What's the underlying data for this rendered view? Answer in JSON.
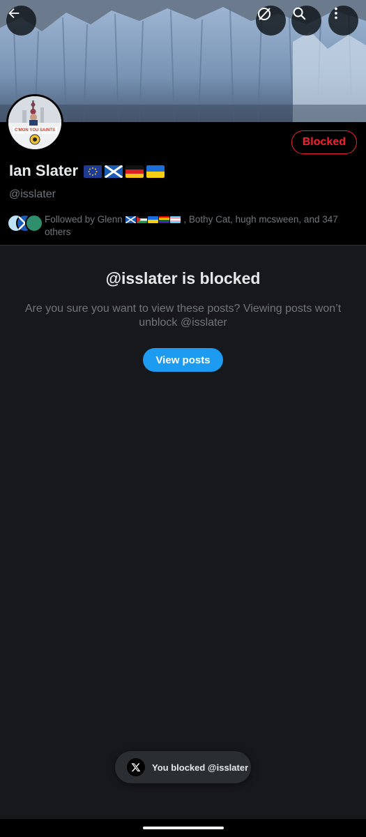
{
  "profile": {
    "name": "Ian Slater",
    "handle": "@isslater",
    "followed_by": "Followed by Glenn",
    "followed_by_rest": ", Bothy Cat, hugh mcsween, and 347 others",
    "avatar_caption": "C'MON YOU SAINTS"
  },
  "header": {
    "blocked_label": "Blocked"
  },
  "icons": {
    "back": "back-arrow-icon",
    "grok": "grok-icon",
    "search": "search-icon",
    "more": "more-vertical-icon"
  },
  "blocked_panel": {
    "title": "@isslater is blocked",
    "description": "Are you sure you want to view these posts? Viewing posts won’t unblock @isslater",
    "view_button": "View posts"
  },
  "toast": {
    "text": "You blocked @isslater"
  },
  "colors": {
    "accent": "#1d9bf0",
    "danger": "#f4212e",
    "background": "#16181c"
  }
}
